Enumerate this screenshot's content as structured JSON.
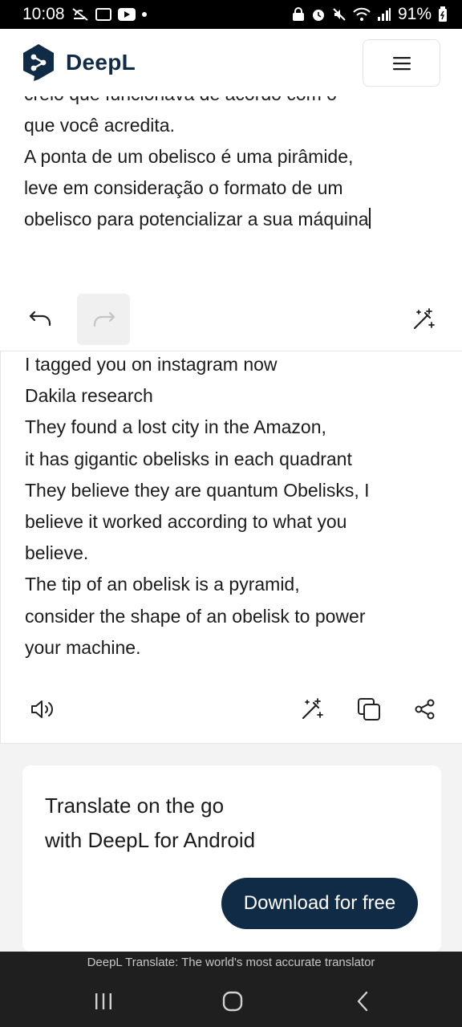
{
  "status_bar": {
    "time": "10:08",
    "battery": "91%",
    "icons": [
      "do-not-disturb-icon",
      "gallery-icon",
      "youtube-icon",
      "dot-icon",
      "lock-icon",
      "alarm-icon",
      "mute-icon",
      "wifi-icon",
      "signal-icon",
      "battery-icon"
    ]
  },
  "header": {
    "brand": "DeepL",
    "menu_icon": "hamburger-icon"
  },
  "source": {
    "text": "creio que funcionava de acordo com o\nque você acredita.\nA ponta de um obelisco é uma pirâmide,\nleve em consideração o formato de um\nobelisco para potencializar a sua máquina",
    "tools": [
      "undo-icon",
      "redo-icon",
      "improve-writing-icon"
    ]
  },
  "target": {
    "text": "I tagged you on instagram now\nDakila research\nThey found a lost city in the Amazon,\nit has gigantic obelisks in each quadrant\nThey believe they are quantum Obelisks, I\nbelieve it worked according to what you\nbelieve.\nThe tip of an obelisk is a pyramid,\nconsider the shape of an obelisk to power\nyour machine.",
    "tools": [
      "speaker-icon",
      "improve-writing-icon",
      "copy-icon",
      "share-icon"
    ]
  },
  "promo": {
    "title": "Translate on the go\nwith DeepL for Android",
    "button": "Download for free"
  },
  "footer": {
    "tagline": "DeepL Translate: The world's most accurate translator"
  },
  "nav": [
    "recent-apps-icon",
    "home-icon",
    "back-icon"
  ],
  "colors": {
    "brand_navy": "#0f2b46",
    "status_bg": "#000000",
    "nav_bg": "#1f1f1f",
    "panel_gray": "#f3f3f3"
  }
}
